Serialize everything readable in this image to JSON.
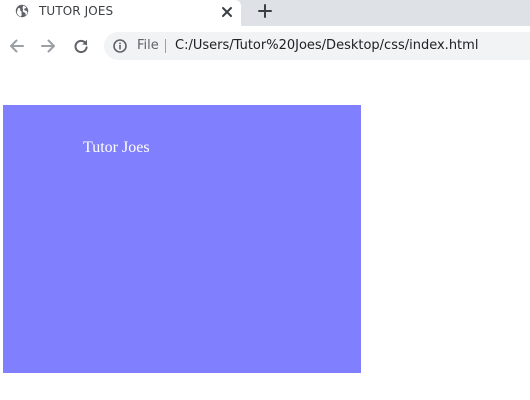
{
  "tab": {
    "title": "TUTOR JOES",
    "favicon": "globe-icon",
    "close_icon": "close-icon"
  },
  "new_tab_icon": "plus-icon",
  "toolbar": {
    "back_icon": "back-arrow-icon",
    "forward_icon": "forward-arrow-icon",
    "reload_icon": "reload-icon"
  },
  "omnibox": {
    "info_icon": "info-icon",
    "scheme_label": "File",
    "url": "C:/Users/Tutor%20Joes/Desktop/css/index.html"
  },
  "page": {
    "box_color": "#8080ff",
    "box_text": "Tutor Joes"
  }
}
